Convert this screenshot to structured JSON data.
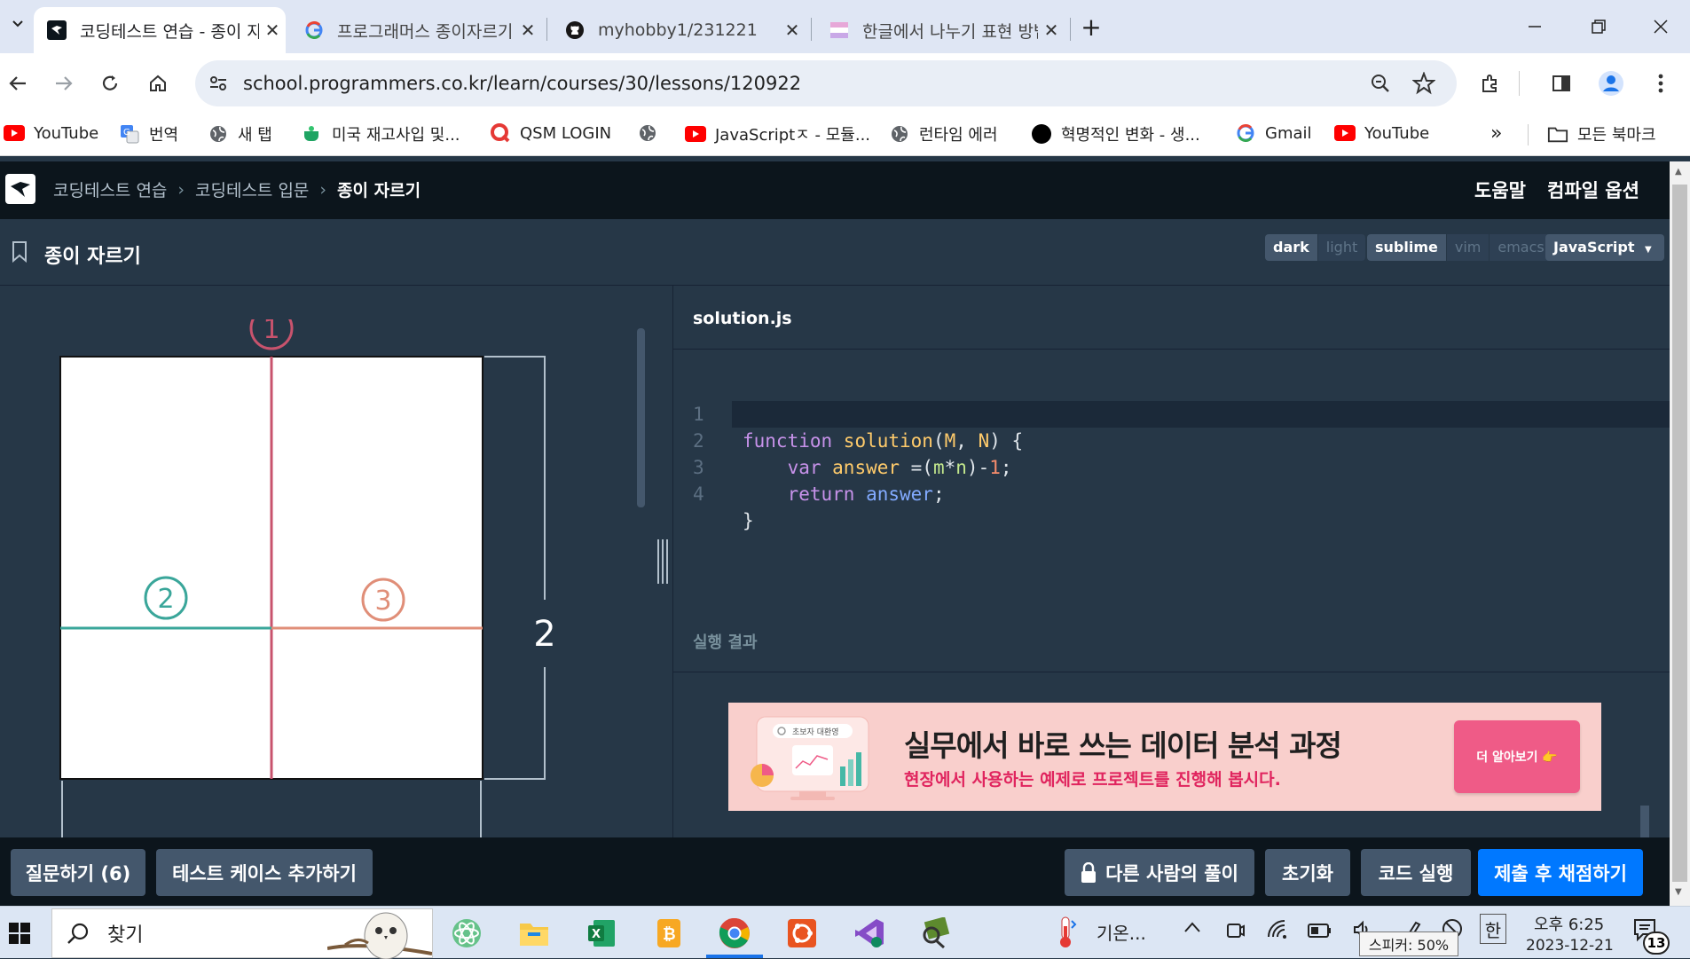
{
  "browser": {
    "tabs": [
      {
        "title": "코딩테스트 연습 - 종이 자르기",
        "active": true,
        "icon": "programmers-icon"
      },
      {
        "title": "프로그래머스 종이자르기 자바",
        "active": false,
        "icon": "google-icon"
      },
      {
        "title": "myhobby1/231221",
        "active": false,
        "icon": "github-icon"
      },
      {
        "title": "한글에서 나누기 표현 방법, 나",
        "active": false,
        "icon": "naver-blog-icon"
      }
    ],
    "new_tab": "+",
    "url": "school.programmers.co.kr/learn/courses/30/lessons/120922",
    "bookmarks": [
      {
        "label": "YouTube",
        "icon": "youtube-icon"
      },
      {
        "label": "번역",
        "icon": "translate-icon"
      },
      {
        "label": "새 탭",
        "icon": "globe-icon"
      },
      {
        "label": "미국 재고사입 및...",
        "icon": "cup-icon"
      },
      {
        "label": "QSM LOGIN",
        "icon": "qsm-icon"
      },
      {
        "label": "",
        "icon": "globe-icon"
      },
      {
        "label": "JavaScriptㅈ - 모듈...",
        "icon": "youtube-icon"
      },
      {
        "label": "런타임 에러",
        "icon": "globe-icon"
      },
      {
        "label": "혁명적인 변화 - 생...",
        "icon": "circle-icon"
      },
      {
        "label": "Gmail",
        "icon": "google-icon"
      },
      {
        "label": "YouTube",
        "icon": "youtube-icon"
      }
    ],
    "more_bookmarks": "»",
    "all_bookmarks": "모든 북마크"
  },
  "header": {
    "breadcrumb": [
      "코딩테스트 연습",
      "코딩테스트 입문",
      "종이 자르기"
    ],
    "help": "도움말",
    "compile_options": "컴파일 옵션"
  },
  "problem": {
    "title": "종이 자르기",
    "theme_options": [
      "dark",
      "light"
    ],
    "keymap_options": [
      "sublime",
      "vim",
      "emacs"
    ],
    "language": "JavaScript"
  },
  "diagram": {
    "cut_labels": [
      "①",
      "②",
      "③"
    ],
    "dimension": "2",
    "colors": {
      "cut1": "#c8536d",
      "cut2": "#3aa69a",
      "cut3": "#e08e78"
    }
  },
  "editor": {
    "filename": "solution.js",
    "lines": [
      {
        "num": "1"
      },
      {
        "num": "2"
      },
      {
        "num": "3"
      },
      {
        "num": "4"
      }
    ],
    "code": {
      "l1_kw": "function ",
      "l1_fn": "solution",
      "l1_p1": "(",
      "l1_m": "M",
      "l1_p2": ", ",
      "l1_n": "N",
      "l1_p3": ") {",
      "l2_kw": "var ",
      "l2_var": "answer",
      "l2_op": " =(",
      "l2_m": "m",
      "l2_star": "*",
      "l2_n": "n",
      "l2_close": ")-",
      "l2_one": "1",
      "l2_semi": ";",
      "l3_kw": "return ",
      "l3_var": "answer",
      "l3_semi": ";",
      "l4": "}"
    }
  },
  "result": {
    "label": "실행 결과"
  },
  "banner": {
    "title": "실무에서 바로 쓰는 데이터 분석 과정",
    "subtitle": "현장에서 사용하는 예제로 프로젝트를 진행해 봅시다.",
    "button": "더 알아보기 👉",
    "search_chip": "초보자 대환영"
  },
  "actions": {
    "question": "질문하기 (6)",
    "add_test": "테스트 케이스 추가하기",
    "others_solution": "다른 사람의 풀이",
    "reset": "초기화",
    "run": "코드 실행",
    "submit": "제출 후 채점하기"
  },
  "taskbar": {
    "search": "찾기",
    "weather": "기온...",
    "ime": "한",
    "time": "오후 6:25",
    "date": "2023-12-21",
    "notifications": "13",
    "tooltip": "스피커: 50%"
  }
}
